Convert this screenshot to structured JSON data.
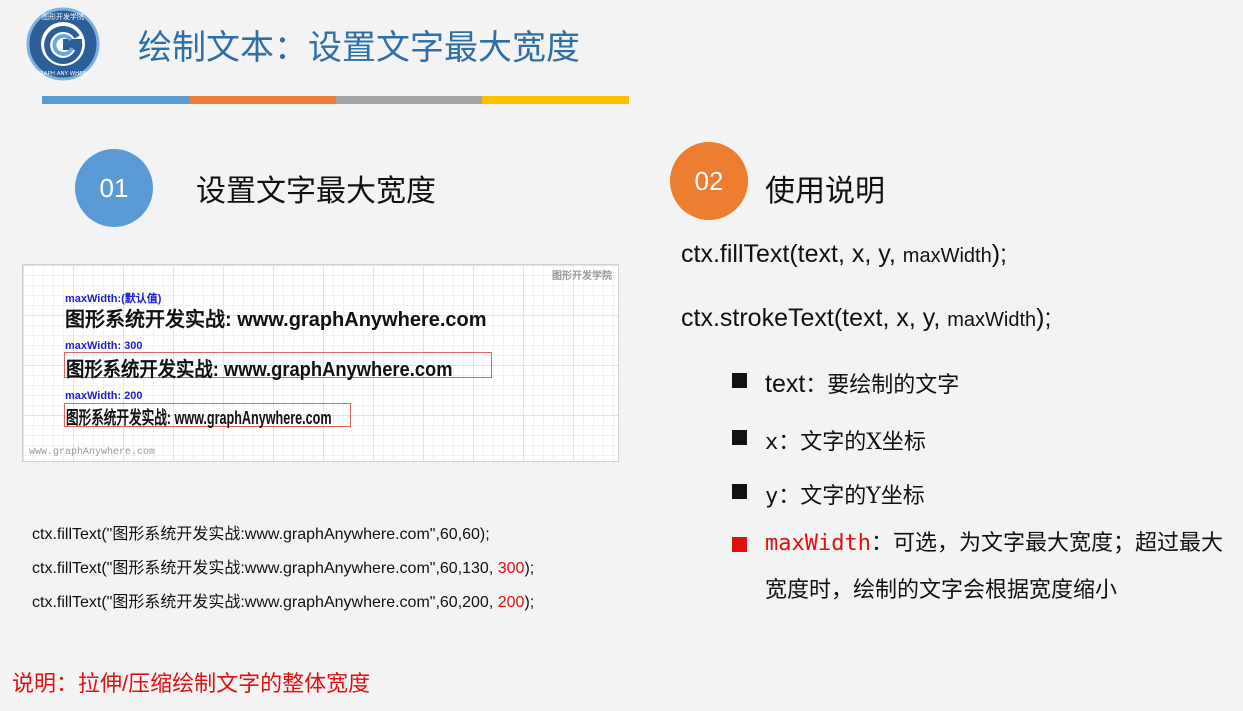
{
  "header": {
    "title": "绘制文本：设置文字最大宽度",
    "logo": {
      "top_text": "图形开发学院",
      "bottom_text": "GRAPH ANY WHERE"
    },
    "bar_colors": [
      "#5b9bd5",
      "#ed7d31",
      "#a5a5a5",
      "#ffc000"
    ]
  },
  "section1": {
    "number": "01",
    "title": "设置文字最大宽度",
    "color": "#5b9bd5",
    "demo": {
      "corner_label": "图形开发学院",
      "footer": "www.graphAnywhere.com",
      "rows": [
        {
          "label": "maxWidth:(默认值)",
          "text": "图形系统开发实战: www.graphAnywhere.com"
        },
        {
          "label": "maxWidth: 300",
          "text": "图形系统开发实战: www.graphAnywhere.com"
        },
        {
          "label": "maxWidth: 200",
          "text": "图形系统开发实战: www.graphAnywhere.com"
        }
      ]
    },
    "code": [
      {
        "main": "ctx.fillText(\"图形系统开发实战:www.graphAnywhere.com\",60,60);",
        "highlight": "",
        "tail": ""
      },
      {
        "main": "ctx.fillText(\"图形系统开发实战:www.graphAnywhere.com\",60,130, ",
        "highlight": "300",
        "tail": ");"
      },
      {
        "main": "ctx.fillText(\"图形系统开发实战:www.graphAnywhere.com\",60,200, ",
        "highlight": "200",
        "tail": ");"
      }
    ],
    "note": "说明：拉伸/压缩绘制文字的整体宽度"
  },
  "section2": {
    "number": "02",
    "title": "使用说明",
    "color": "#ed7d31",
    "api": [
      {
        "main": "ctx.fillText(text, x, y, ",
        "small": "maxWidth",
        "tail": ");"
      },
      {
        "main": "ctx.strokeText(text, x, y, ",
        "small": "maxWidth",
        "tail": ");"
      }
    ],
    "params": [
      {
        "name": "text",
        "desc": "：要绘制的文字"
      },
      {
        "name": "x",
        "desc": "：文字的X坐标"
      },
      {
        "name": "y",
        "desc": "：文字的Y坐标"
      },
      {
        "name": "maxWidth",
        "desc": "：可选，为文字最大宽度；超过最大宽度时，绘制的文字会根据宽度缩小"
      }
    ]
  }
}
